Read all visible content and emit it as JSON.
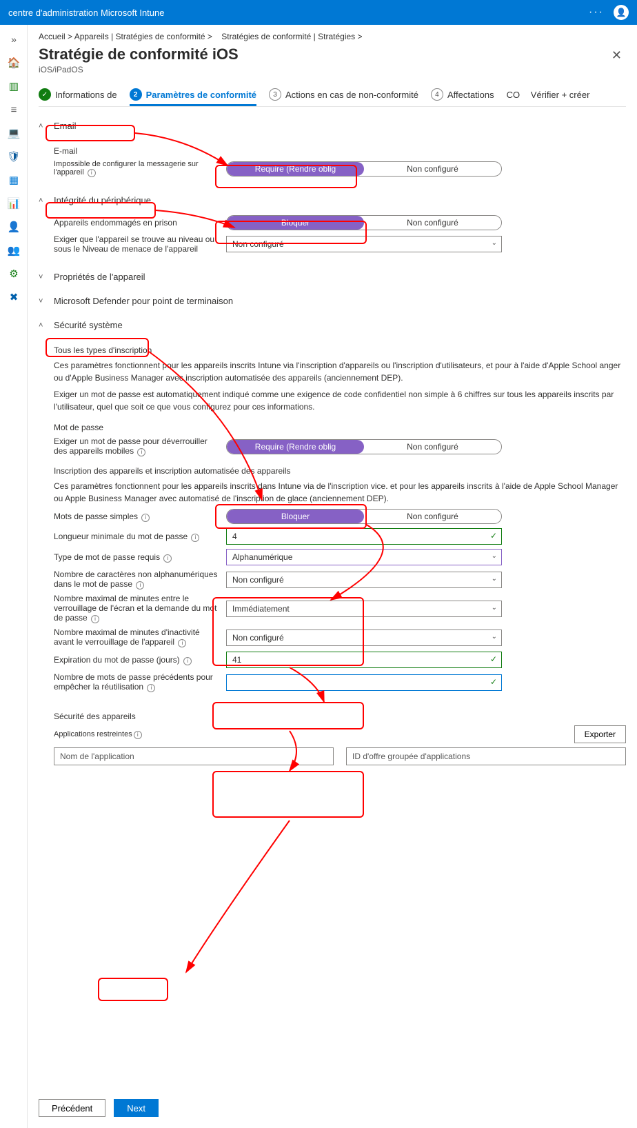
{
  "topbar": {
    "title": "centre d'administration Microsoft Intune"
  },
  "breadcrumb": {
    "home": "Accueil >",
    "devices": "Appareils | Stratégies de conformité >",
    "policies": "Stratégies de conformité | Stratégies >"
  },
  "page": {
    "title": "Stratégie de conformité iOS",
    "subtitle": "iOS/iPadOS"
  },
  "steps": {
    "s1": "Informations de",
    "s2": "Paramètres de conformité",
    "s3": "Actions en cas de non-conformité",
    "s4": "Affectations",
    "s5pre": "CO",
    "s5": "Vérifier + créer"
  },
  "email": {
    "header": "Email",
    "label": "E-mail",
    "setting_label": "Impossible de configurer la messagerie sur l'appareil",
    "require": "Require (Rendre oblig",
    "not_configured": "Non configuré"
  },
  "device_health": {
    "header": "Intégrité du périphérique",
    "jailbroken_label": "Appareils endommagés en prison",
    "block": "Bloquer",
    "not_configured": "Non configuré",
    "threat_label": "Exiger que l'appareil se trouve au niveau ou sous le Niveau de menace de l'appareil",
    "threat_value": "Non configuré"
  },
  "device_props": {
    "header": "Propriétés de l'appareil"
  },
  "defender": {
    "header": "Microsoft Defender pour point de terminaison"
  },
  "syssec": {
    "header": "Sécurité système",
    "all_enroll": "Tous les types d'inscription",
    "para1": "Ces paramètres fonctionnent pour les appareils inscrits        Intune via l'inscription d'appareils ou l'inscription d'utilisateurs, et pour à l'aide d'Apple School anger ou d'Apple Business Manager avec inscription automatisée des appareils (anciennement DEP).",
    "para2": "Exiger un mot de passe est automatiquement indiqué comme une exigence de code confidentiel non simple à 6 chiffres sur tous les appareils inscrits par l'utilisateur, quel que soit ce que vous configurez pour ces informations.",
    "password_h": "Mot de passe",
    "req_pwd_label": "Exiger un mot de passe pour déverrouiller des appareils mobiles",
    "require": "Require (Rendre oblig",
    "not_configured": "Non configuré",
    "auto_h": "Inscription des appareils et inscription automatisée des appareils",
    "para3": "Ces paramètres fonctionnent pour les appareils inscrits dans     Intune via             de l'inscription vice. et pour les appareils inscrits à l'aide de Apple School Manager ou Apple Business Manager avec automatisé       de l'inscription de glace (anciennement DEP).",
    "simple_label": "Mots de passe simples",
    "block": "Bloquer",
    "minlen_label": "Longueur minimale du mot de passe",
    "minlen_value": "4",
    "pwtype_label": "Type de mot de passe requis",
    "pwtype_value": "Alphanumérique",
    "nonalpha_label": "Nombre de caractères non alphanumériques dans le mot de passe",
    "nonalpha_value": "Non configuré",
    "maxlock_label": "Nombre maximal de minutes entre le verrouillage de l'écran et la demande du mot de passe",
    "maxlock_value": "Immédiatement",
    "maxidle_label": "Nombre maximal de minutes d'inactivité avant le verrouillage de l'appareil",
    "maxidle_value": "Non configuré",
    "expire_label": "Expiration du mot de passe (jours)",
    "expire_value": "41",
    "prev_label": "Nombre de mots de passe précédents pour empêcher la réutilisation",
    "prev_value": "",
    "devicesec_h": "Sécurité des appareils",
    "restricted_label": "Applications restreintes",
    "export": "Exporter",
    "appname_ph": "Nom de l'application",
    "bundleid_ph": "ID d'offre groupée d'applications"
  },
  "footer": {
    "prev": "Précédent",
    "next": "Next"
  }
}
